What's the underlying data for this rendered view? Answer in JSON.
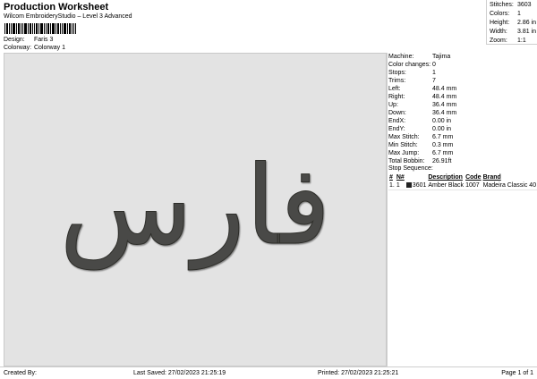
{
  "header": {
    "title": "Production Worksheet",
    "subtitle": "Wilcom EmbroideryStudio – Level 3 Advanced",
    "design_label": "Design:",
    "design_value": "Faris 3",
    "colorway_label": "Colorway:",
    "colorway_value": "Colorway 1"
  },
  "stats": [
    {
      "label": "Stitches:",
      "value": "3603"
    },
    {
      "label": "Colors:",
      "value": "1"
    },
    {
      "label": "Height:",
      "value": "2.86 in"
    },
    {
      "label": "Width:",
      "value": "3.81 in"
    },
    {
      "label": "Zoom:",
      "value": "1:1"
    }
  ],
  "params": [
    {
      "label": "Machine:",
      "value": "Tajima"
    },
    {
      "label": "Color changes:",
      "value": "0"
    },
    {
      "label": "Stops:",
      "value": "1"
    },
    {
      "label": "Trims:",
      "value": "7"
    },
    {
      "label": "Left:",
      "value": "48.4 mm"
    },
    {
      "label": "Right:",
      "value": "48.4 mm"
    },
    {
      "label": "Up:",
      "value": "36.4 mm"
    },
    {
      "label": "Down:",
      "value": "36.4 mm"
    },
    {
      "label": "EndX:",
      "value": "0.00 in"
    },
    {
      "label": "EndY:",
      "value": "0.00 in"
    },
    {
      "label": "Max Stitch:",
      "value": "6.7 mm"
    },
    {
      "label": "Min Stitch:",
      "value": "0.3 mm"
    },
    {
      "label": "Max Jump:",
      "value": "6.7 mm"
    },
    {
      "label": "Total Bobbin:",
      "value": "26.91ft"
    }
  ],
  "stop_sequence": {
    "title": "Stop Sequence:",
    "columns": [
      "#",
      "N#",
      "",
      "Description",
      "Code",
      "Brand"
    ],
    "rows": [
      {
        "idx": "1.",
        "n": "1",
        "swatch_color": "#222222",
        "code_num": "3601",
        "description": "Amber Black",
        "code": "1007",
        "brand": "Madeira Classic 40"
      }
    ]
  },
  "design_text": "فارس",
  "colors": {
    "thread": "#4a4a46",
    "canvas_bg": "#e3e3e3"
  },
  "footer": {
    "created_by": "Created By:",
    "last_saved": "Last Saved: 27/02/2023 21:25:19",
    "printed": "Printed: 27/02/2023 21:25:21",
    "page": "Page 1 of 1"
  }
}
